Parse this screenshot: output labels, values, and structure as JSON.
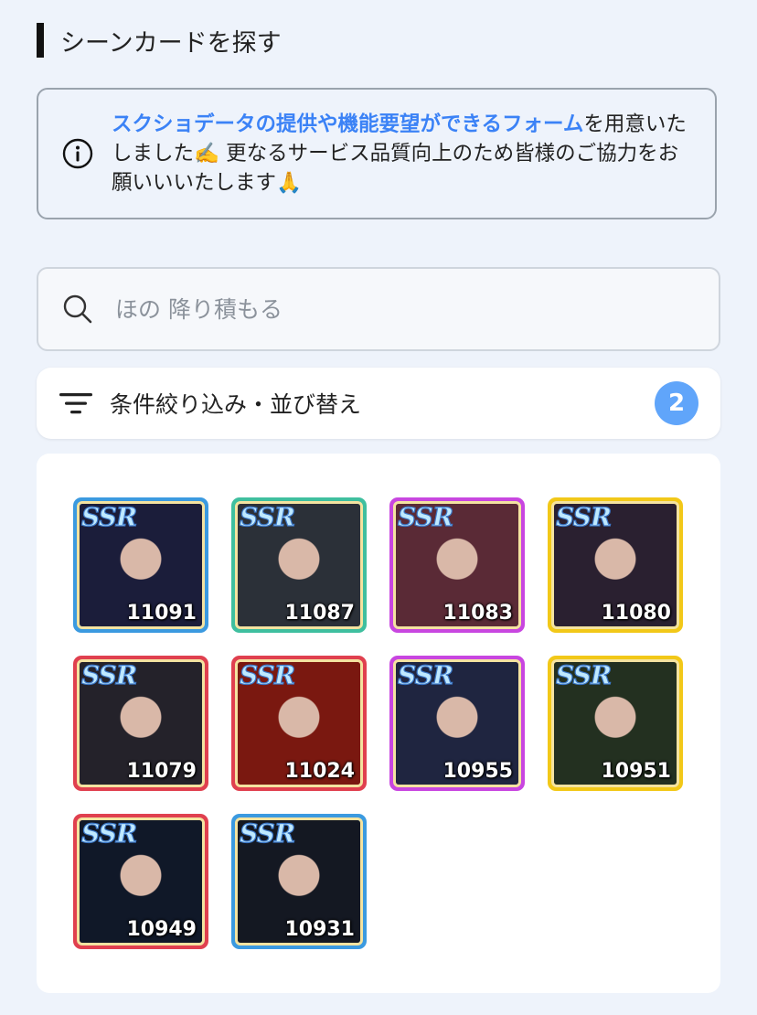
{
  "section_title": "シーンカードを探す",
  "notice": {
    "link_text": "スクショデータの提供や機能要望ができるフォーム",
    "text": "を用意いたしました✍️ 更なるサービス品質向上のため皆様のご協力をお願いいいたします🙏"
  },
  "search": {
    "placeholder": "ほの 降り積もる",
    "value": ""
  },
  "filter": {
    "label": "条件絞り込み・並び替え",
    "badge_count": "2"
  },
  "colors": {
    "blue": "#3b9ae0",
    "teal": "#3fbf9f",
    "purple": "#c846e0",
    "yellow": "#f2c818",
    "red": "#e0404f",
    "link": "#3b82f6",
    "badge": "#60a5fa"
  },
  "cards": [
    {
      "rarity": "SSR",
      "number": "11091",
      "frame": "blue",
      "photo": "#1b1d3a"
    },
    {
      "rarity": "SSR",
      "number": "11087",
      "frame": "teal",
      "photo": "#2b3038"
    },
    {
      "rarity": "SSR",
      "number": "11083",
      "frame": "purple",
      "photo": "#5a2a36"
    },
    {
      "rarity": "SSR",
      "number": "11080",
      "frame": "yellow",
      "photo": "#2a2030"
    },
    {
      "rarity": "SSR",
      "number": "11079",
      "frame": "red",
      "photo": "#24222a"
    },
    {
      "rarity": "SSR",
      "number": "11024",
      "frame": "red",
      "photo": "#7a1810"
    },
    {
      "rarity": "SSR",
      "number": "10955",
      "frame": "purple",
      "photo": "#1f2540"
    },
    {
      "rarity": "SSR",
      "number": "10951",
      "frame": "yellow",
      "photo": "#233020"
    },
    {
      "rarity": "SSR",
      "number": "10949",
      "frame": "red",
      "photo": "#101828"
    },
    {
      "rarity": "SSR",
      "number": "10931",
      "frame": "blue",
      "photo": "#141822"
    }
  ]
}
